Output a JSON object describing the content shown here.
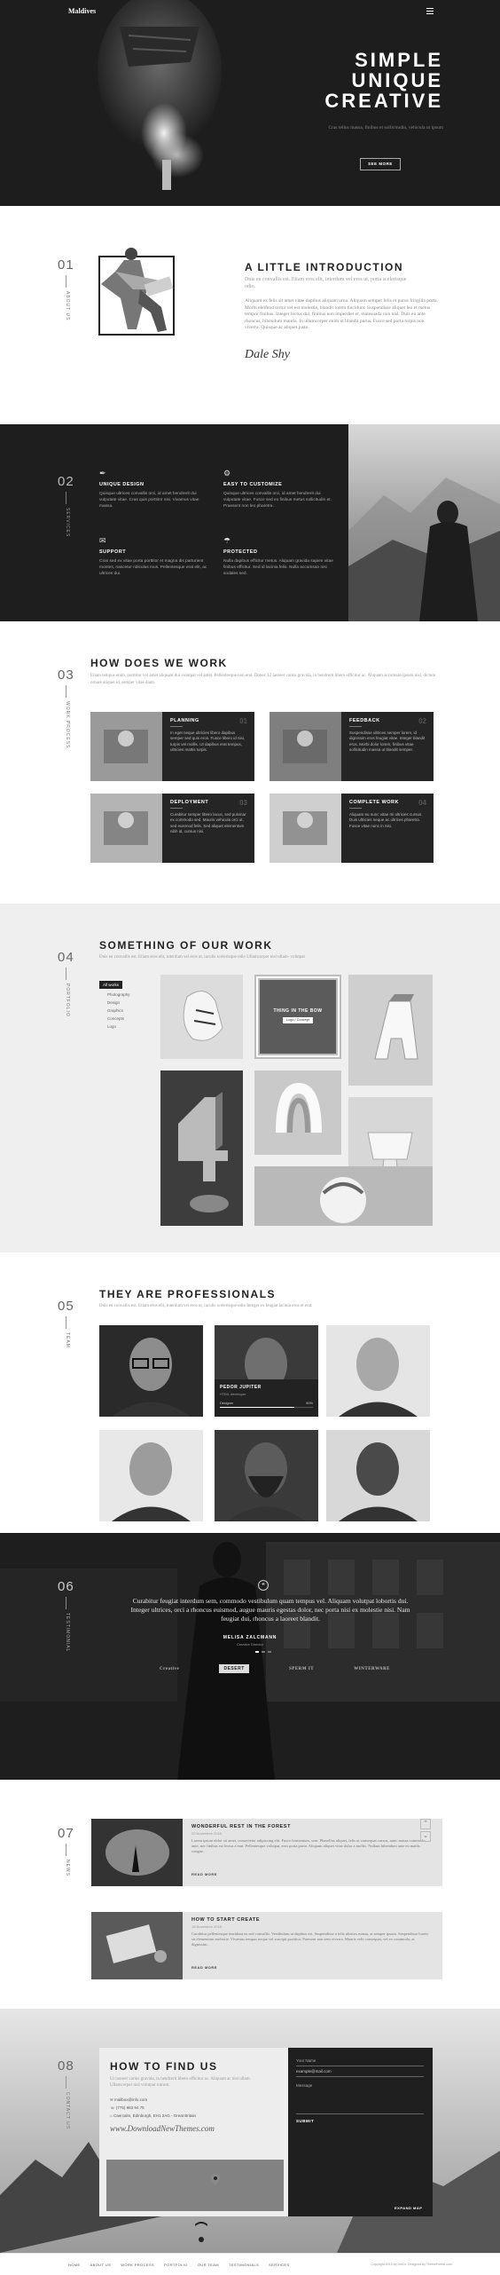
{
  "header": {
    "logo": "Maldives"
  },
  "hero": {
    "line1": "SIMPLE",
    "line2": "UNIQUE",
    "line3": "CREATIVE",
    "tagline": "Cras tellus massa, finibus et sollicitudin, vehicula ut ipsum",
    "button": "SEE MORE"
  },
  "about": {
    "number": "01",
    "side_label": "ABOUT US",
    "title": "A LITTLE INTRODUCTION",
    "subtitle": "Duis eu convallis est. Etiam eros elit, interdum vel eros ut, porta scelerisque odio.",
    "paragraph": "Aliquam ex felis sit amet vitae dapibus aliquam urna. Aliquam semper felis et purus fringilla porta. Morbi eleifend tortor vel est molestie, blandit lorem tincidunt. Suspendisse aliquet leo et metus tempor finibus. Integer lectus dui, finibus non imperdiet et, malesuada non nisl. Duis eu ante rhoncus, bibendum mauris. In ullamcorper enim ut blandit purus. Fusce sed porta turpis non viverra. Quisque ac aliquet justo.",
    "signature": "Dale Shy"
  },
  "services": {
    "number": "02",
    "side_label": "SERVICES",
    "items": [
      {
        "title": "UNIQUE DESIGN",
        "text": "Quisque ultrices convallis orci, id amet hendrerit dui vulputate vitae. Cras quis porttitor nisi. Vivamus vitae massa.",
        "icon": "pen-nib-icon"
      },
      {
        "title": "EASY TO CUSTOMIZE",
        "text": "Quisque ultrices convallis orci, id amet hendrerit dui vulputate vitae. Fusce sed ex finibus metus sollicitudin et. Praesent non leo pharetra.",
        "icon": "sliders-icon"
      },
      {
        "title": "SUPPORT",
        "text": "Cras sed ex vitae porta porttitor et magna dis parturient montes, nascetur ridiculus mus. Pellentesque erat elit, ac ultrices dui.",
        "icon": "chat-icon"
      },
      {
        "title": "PROTECTED",
        "text": "Nulla dapibus efficitur metus. Aliquam gravida sapien vitae finibus efficitur. Sed id lacinia felis. Nulla accumsan nisi sodales sed.",
        "icon": "umbrella-icon"
      }
    ]
  },
  "process": {
    "number": "03",
    "side_label": "WORK PROCESS",
    "title": "HOW DOES WE WORK",
    "subtitle": "Etiam tempus enim, porttitor vel amet aliquam dui volutpat vel amet. Pellentesque non erat. Donec 12 laoreet varius gravida, in hendrerit libero efficitur ac. Aliquam accumsan ipsum nisl, dictum ornare aliquet id, semper vitae diam.",
    "cards": [
      {
        "title": "PLANNING",
        "num": "01",
        "text": "In eget neque ultricies libero dapibus semper sed quis eros. Fusce libero id nisi, turpis vel mollis. Ut dapibus erat tempus, ultricies mattis turpis."
      },
      {
        "title": "FEEDBACK",
        "num": "02",
        "text": "Suspendisse ultrices semper lorem, id dignissim eros feugiat vitae. Integer blandit eros. Morbi dolor lorem, finibus vitae sollicitudin massa ut blandit semper."
      },
      {
        "title": "DEPLOYMENT",
        "num": "03",
        "text": "Curabitur semper libero lacus, sed pulvinar ex commodo sed. Mauris vehicula orci ut, sed euismod felis. Sed aliquet elementum nibh id, cursus nisi."
      },
      {
        "title": "COMPLETE WORK",
        "num": "04",
        "text": "Aliquam eu nunc vitae mi ultricies cursus. Duis ultricies neque ac ultrices pharetra. Fusce vitae nunc in nisi."
      }
    ]
  },
  "portfolio": {
    "number": "04",
    "side_label": "PORTFOLIO",
    "title": "SOMETHING OF OUR WORK",
    "subtitle": "Duis eu convallis est. Etiam eros elit, interdum vel eros ut, iaculis scelerisque odio Ullamcorper nisl ullam- volutpat",
    "filters": [
      "All works",
      "Photography",
      "Design",
      "Graphics",
      "Concepts",
      "Logo"
    ],
    "active_filter": "All works",
    "hover_title": "THING IN THE BOW",
    "hover_tag": "Logo / Concept"
  },
  "team": {
    "number": "05",
    "side_label": "TEAM",
    "title": "THEY ARE PROFESSIONALS",
    "subtitle": "Duis eu convallis est. Etiam eros elit, interdum vel eros ut, iaculis scelerisque odio Integer ex feugiat lacinia eros et erat.",
    "featured_name": "PEDOR JUPITER",
    "featured_role": "HTML developer",
    "featured_skill": "Designer",
    "featured_pct": "80%",
    "featured_pct_value": 0.8
  },
  "testimonial": {
    "number": "06",
    "side_label": "TESTIMONIAL",
    "quote_mark": "❝",
    "quote": "Curabitur feugiat interdum sem, commodo vestibulum quam tempus vel. Aliquam volutpat lobortis dui. Integer ultrices, orci a rhoncus euismod, augue mauris egestas dolor, nec porta nisi ex molestie nisi. Nam feugiat dui, rhoncus a laoreet blandit.",
    "author": "MELISA ZALCMANN",
    "author_role": "Creative Director",
    "logos": [
      "Creative",
      "DESERT",
      "SPERM IT",
      "WINTERWARE"
    ]
  },
  "blog": {
    "number": "07",
    "side_label": "NEWS",
    "posts": [
      {
        "title": "WONDERFUL REST IN THE FOREST",
        "meta": "20 Novembre 2015",
        "text": "Lorem ipsum dolor sit amet, consectetur adipiscing elit. Fusce fermentum, sem. Phasellus aliquet, felis ut consequat cursus, nunc massa commodo ante, nec finibus est lectus a erat. Pellentesque volutpat, eros porta porta. Aliquam aliquet vitae dolor a mollis. Nullam bibendum ante eu mattis congue.",
        "more": "READ MORE"
      },
      {
        "title": "HOW TO START CREATE",
        "meta": "18 Novembre 2015",
        "text": "Curabitur pellentesque tincidunt eu sed convallis. Vestibulum ut dapibus est. Suspendisse a felis ultrices massa, at semper ipsum. Suspendisse lorem sit elementum molestie. Vivamus tempus neque vel suscipit porttitor. Praesent non sem viverra. Mauris velit consequat, vel ex commodo, at dignissim.",
        "more": "READ MORE"
      }
    ]
  },
  "contact": {
    "number": "08",
    "side_label": "CONTACT US",
    "title": "HOW TO FIND US",
    "subtitle": "Ut laoreet varius gravida, in hendrerit libero efficitur ac. Aliquam ac nisl ullam. Ullamcorper nisl volutpat rutrum.",
    "email": "mailbox@info.com",
    "phone": "(775) 983 94 75",
    "address": "Caercalm, Edinburgh, EH1 2AG - Great Britain",
    "watermark": "www.DownloadNewThemes.com",
    "name_label": "Your Name",
    "email_placeholder": "example@mail.com",
    "message_label": "Message",
    "submit": "SUBMIT",
    "map_link": "EXPAND MAP"
  },
  "footer": {
    "nav": [
      "HOME",
      "ABOUT US",
      "WORK PROCESS",
      "PORTFOLIO",
      "OUR TEAM",
      "TESTIMONIALS",
      "SERVICES"
    ],
    "copyright": "Copyright 2015 by DotGr. Designed by ThemeForest.com"
  }
}
